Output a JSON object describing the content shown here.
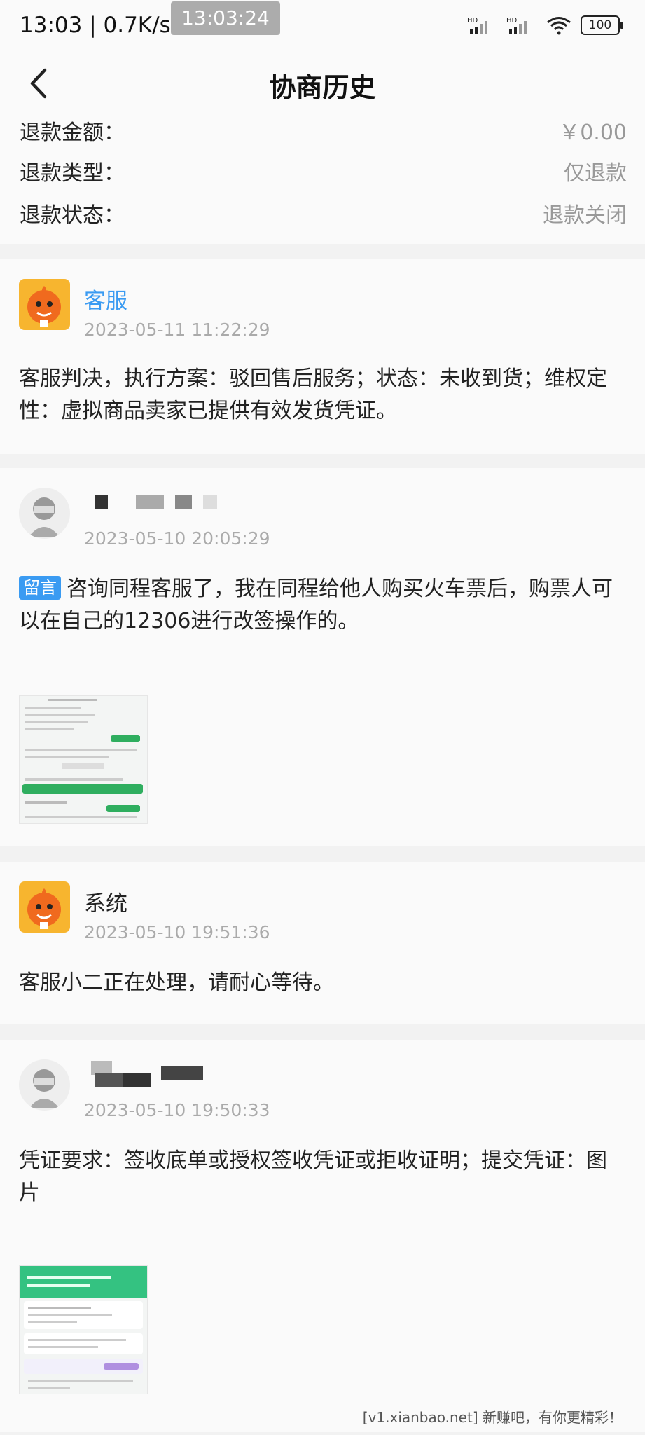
{
  "status_bar": {
    "time": "13:03 | 0.7K/s",
    "overlay_time": "13:03:24",
    "battery": "100",
    "network_labels": [
      "HD",
      "HD"
    ]
  },
  "nav": {
    "title": "协商历史"
  },
  "summary": {
    "rows": [
      {
        "label": "退款金额：",
        "value": "￥0.00"
      },
      {
        "label": "退款类型：",
        "value": "仅退款"
      },
      {
        "label": "退款状态：",
        "value": "退款关闭"
      }
    ]
  },
  "history": [
    {
      "author": "客服",
      "time": "2023-05-11 11:22:29",
      "text": "客服判决，执行方案：驳回售后服务；状态：未收到货；维权定性：虚拟商品卖家已提供有效发货凭证。"
    },
    {
      "author": "",
      "time": "2023-05-10 20:05:29",
      "tag": "留言",
      "text": "咨询同程客服了，我在同程给他人购买火车票后，购票人可以在自己的12306进行改签操作的。"
    },
    {
      "author": "系统",
      "time": "2023-05-10 19:51:36",
      "text": "客服小二正在处理，请耐心等待。"
    },
    {
      "author": "",
      "time": "2023-05-10 19:50:33",
      "text": "凭证要求：签收底单或授权签收凭证或拒收证明；提交凭证：图片"
    }
  ],
  "watermark": "[v1.xianbao.net] 新赚吧，有你更精彩！",
  "colors": {
    "accent_blue": "#3a9bf2",
    "mascot_orange": "#f7b52f",
    "muted": "#999999"
  }
}
